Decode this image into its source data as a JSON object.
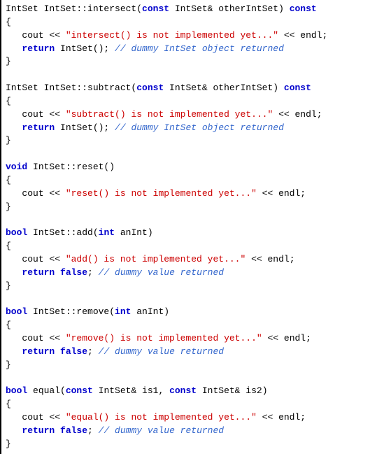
{
  "code": {
    "kw_const": "const",
    "kw_return": "return",
    "kw_void": "void",
    "kw_bool": "bool",
    "kw_false": "false",
    "intersect": {
      "sig_pre": "IntSet IntSet::intersect(",
      "sig_param_type": " IntSet& otherIntSet) ",
      "brace_open": "{",
      "cout_pre": "   cout << ",
      "str": "\"intersect() is not implemented yet...\"",
      "cout_post": " << endl;",
      "ret_pre": "   ",
      "ret_post": " IntSet(); ",
      "cmt": "// dummy IntSet object returned",
      "brace_close": "}"
    },
    "subtract": {
      "sig_pre": "IntSet IntSet::subtract(",
      "sig_param_type": " IntSet& otherIntSet) ",
      "brace_open": "{",
      "cout_pre": "   cout << ",
      "str": "\"subtract() is not implemented yet...\"",
      "cout_post": " << endl;",
      "ret_pre": "   ",
      "ret_post": " IntSet(); ",
      "cmt": "// dummy IntSet object returned",
      "brace_close": "}"
    },
    "reset": {
      "sig_post": " IntSet::reset()",
      "brace_open": "{",
      "cout_pre": "   cout << ",
      "str": "\"reset() is not implemented yet...\"",
      "cout_post": " << endl;",
      "brace_close": "}"
    },
    "add": {
      "sig_post": " IntSet::add(",
      "sig_param_type": " anInt)",
      "kw_int": "int",
      "brace_open": "{",
      "cout_pre": "   cout << ",
      "str": "\"add() is not implemented yet...\"",
      "cout_post": " << endl;",
      "ret_pre": "   ",
      "ret_mid": " ",
      "ret_post": "; ",
      "cmt": "// dummy value returned",
      "brace_close": "}"
    },
    "remove": {
      "sig_post": " IntSet::remove(",
      "sig_param_type": " anInt)",
      "kw_int": "int",
      "brace_open": "{",
      "cout_pre": "   cout << ",
      "str": "\"remove() is not implemented yet...\"",
      "cout_post": " << endl;",
      "ret_pre": "   ",
      "ret_mid": " ",
      "ret_post": "; ",
      "cmt": "// dummy value returned",
      "brace_close": "}"
    },
    "equal": {
      "sig_post": " equal(",
      "sig_p1": " IntSet& is1, ",
      "sig_p2": " IntSet& is2)",
      "brace_open": "{",
      "cout_pre": "   cout << ",
      "str": "\"equal() is not implemented yet...\"",
      "cout_post": " << endl;",
      "ret_pre": "   ",
      "ret_mid": " ",
      "ret_post": "; ",
      "cmt": "// dummy value returned",
      "brace_close": "}"
    }
  }
}
